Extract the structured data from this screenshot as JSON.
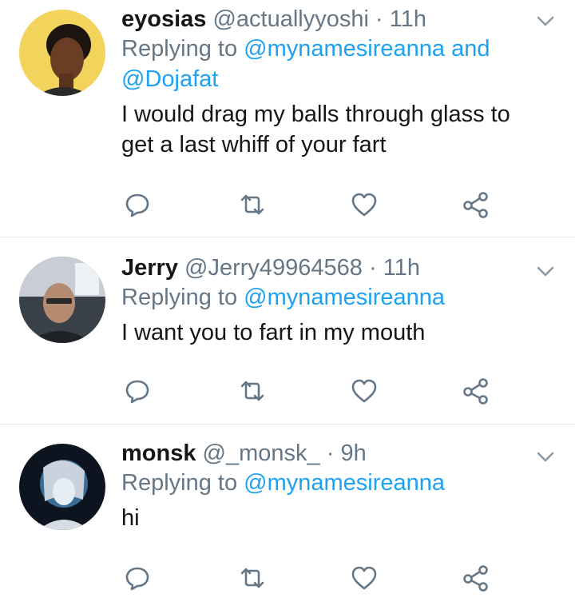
{
  "tweets": [
    {
      "name": "eyosias",
      "handle": "@actuallyyoshi",
      "separator": "·",
      "time": "11h",
      "replying_prefix": "Replying to",
      "mentions": [
        "@mynamesireanna",
        "@Dojafat"
      ],
      "mention_join": "and",
      "text": "I would drag my balls through glass to get a last whiff of your fart",
      "avatar_bg": "#f2d45c"
    },
    {
      "name": "Jerry",
      "handle": "@Jerry49964568",
      "separator": "·",
      "time": "11h",
      "replying_prefix": "Replying to",
      "mentions": [
        "@mynamesireanna"
      ],
      "text": "I want you to fart in my mouth",
      "avatar_bg": "#3a4048"
    },
    {
      "name": "monsk",
      "handle": "@_monsk_",
      "separator": "·",
      "time": "9h",
      "replying_prefix": "Replying to",
      "mentions": [
        "@mynamesireanna"
      ],
      "text": "hi",
      "avatar_bg": "#0e1320"
    }
  ],
  "actions": [
    "reply-icon",
    "retweet-icon",
    "like-icon",
    "share-icon"
  ],
  "colors": {
    "mention": "#1da1f2",
    "secondary_text": "#657786",
    "icon": "#657786",
    "divider": "#e1e8ed"
  }
}
